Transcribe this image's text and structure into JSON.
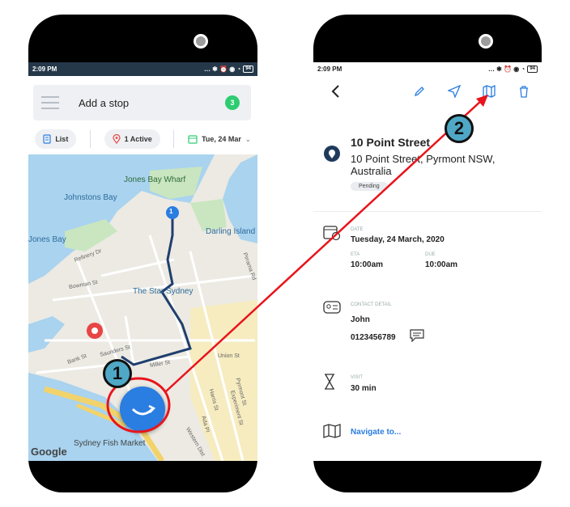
{
  "status": {
    "time": "2:09 PM",
    "battery": "94"
  },
  "list_screen": {
    "add_stop_label": "Add a stop",
    "stop_count": "3",
    "filter_list": "List",
    "filter_active": "1 Active",
    "filter_date": "Tue, 24 Mar",
    "map": {
      "labels": [
        "Jones Bay Wharf",
        "Johnstons Bay",
        "Jones Bay",
        "Darling Island",
        "The Star Sydney",
        "Sydney Fish Market"
      ],
      "streets": [
        "Refinery Dr",
        "Bowman St",
        "Pirrama Rd",
        "Bank St",
        "Union St",
        "Miller St",
        "Saunders St",
        "Harris St",
        "Pyrmont St",
        "Experiment St",
        "Ada Pl",
        "Western Dist"
      ],
      "marker_number": "1",
      "attribution": "Google"
    }
  },
  "detail_screen": {
    "title": "10 Point Street",
    "address": "10 Point Street, Pyrmont NSW, Australia",
    "status_tag": "Pending",
    "date_label": "DATE",
    "date_value": "Tuesday, 24 March, 2020",
    "eta_label": "ETA",
    "eta_value": "10:00am",
    "due_label": "DUE",
    "due_value": "10:00am",
    "contact_label": "CONTACT DETAIL",
    "contact_name": "John",
    "contact_phone": "0123456789",
    "visit_label": "VISIT",
    "visit_value": "30 min",
    "navigate_label": "Navigate to..."
  },
  "annotations": {
    "step1": "1",
    "step2": "2",
    "arrow_color": "#e8141c"
  },
  "colors": {
    "brand_blue": "#2a7de1",
    "badge_green": "#2ecc71",
    "route": "#1f3f6e",
    "marker_red": "#e84545"
  }
}
